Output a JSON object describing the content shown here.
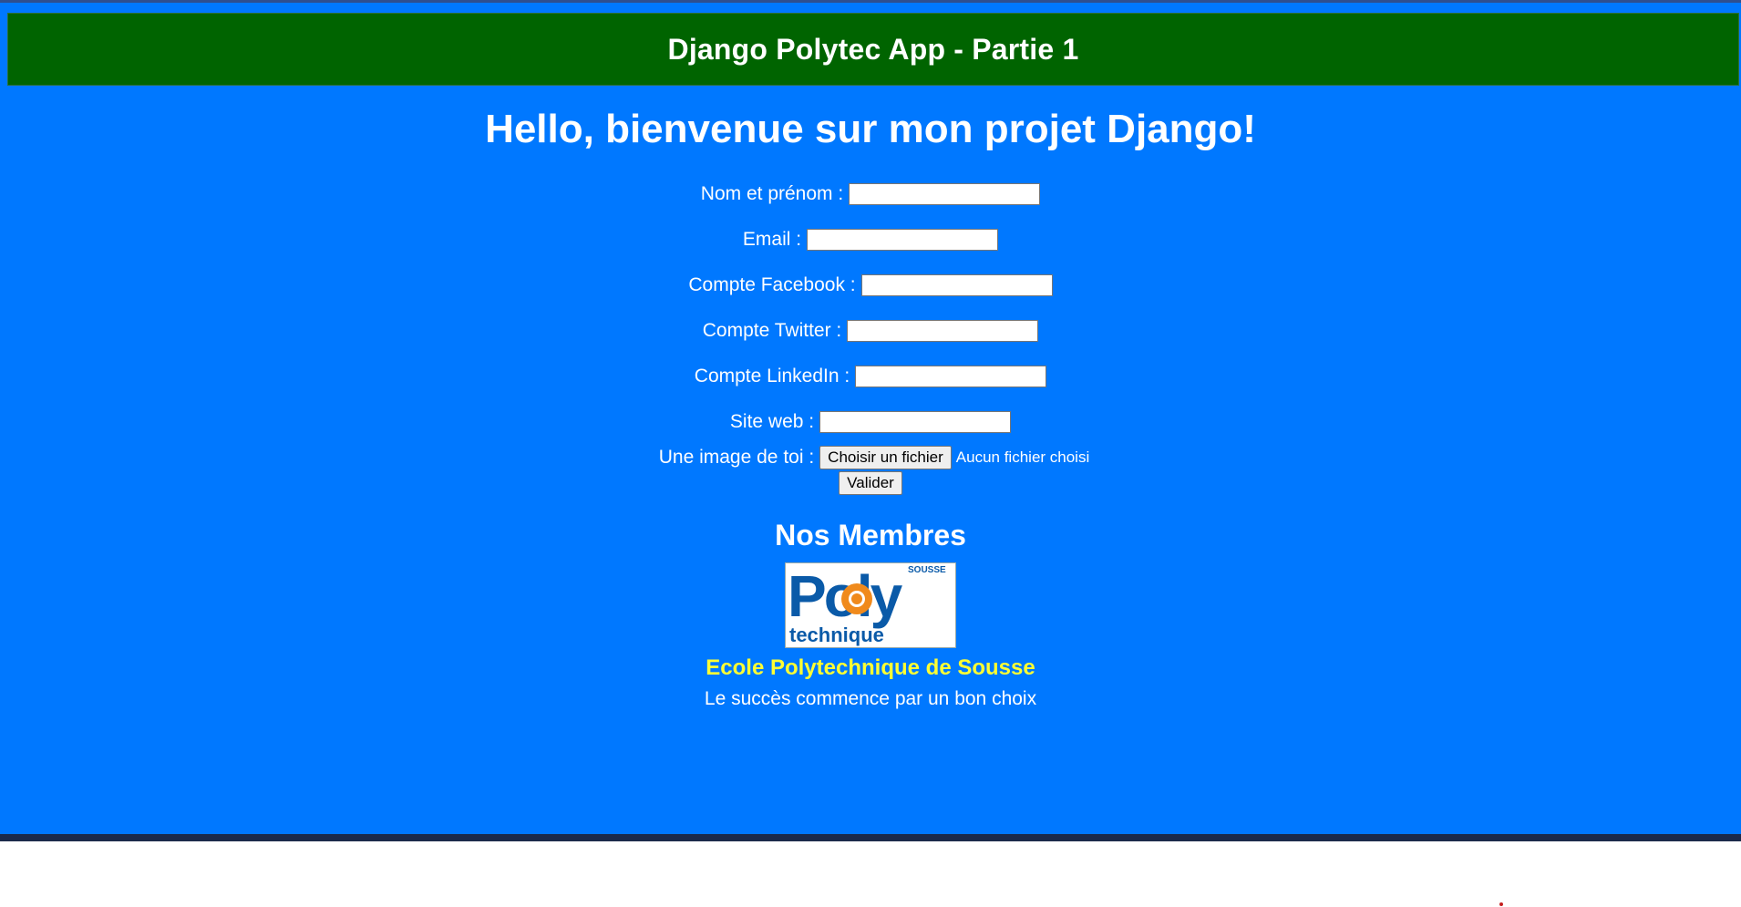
{
  "header": {
    "title": "Django Polytec App - Partie 1"
  },
  "main": {
    "heading": "Hello, bienvenue sur mon projet Django!"
  },
  "form": {
    "fields": [
      {
        "label": "Nom et prénom :",
        "value": ""
      },
      {
        "label": "Email :",
        "value": ""
      },
      {
        "label": "Compte Facebook :",
        "value": ""
      },
      {
        "label": "Compte Twitter :",
        "value": ""
      },
      {
        "label": "Compte LinkedIn :",
        "value": ""
      },
      {
        "label": "Site web :",
        "value": ""
      }
    ],
    "image_label": "Une image de toi :",
    "file_button": "Choisir un fichier",
    "file_status": "Aucun fichier choisi",
    "submit_label": "Valider"
  },
  "members": {
    "heading": "Nos Membres",
    "logo": {
      "big_text": "Poly",
      "small_text": "technique",
      "tag": "SOUSSE",
      "colors": {
        "blue": "#0a5aa8",
        "orange": "#f08a1c"
      }
    },
    "name": "Ecole Polytechnique de Sousse",
    "slogan": "Le succès commence par un bon choix"
  },
  "colors": {
    "page_background": "#0078ff",
    "banner_background": "#006400",
    "school_name": "#ffff33"
  }
}
